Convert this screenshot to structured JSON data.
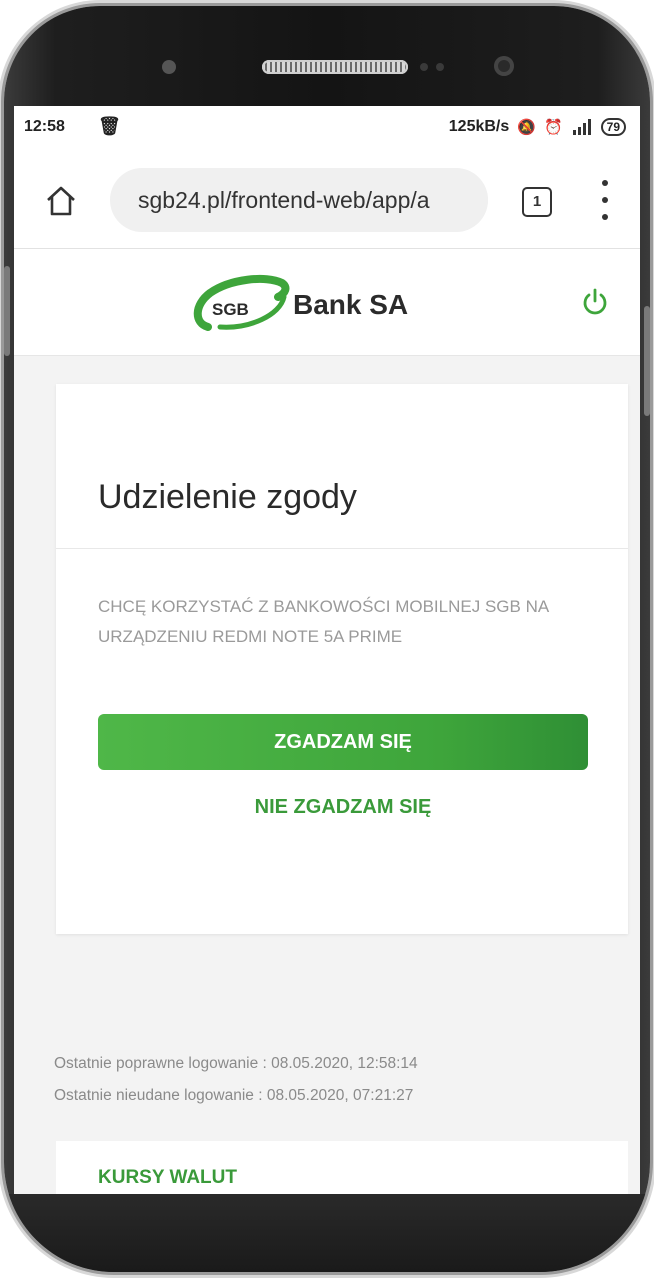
{
  "status_bar": {
    "time": "12:58",
    "trash_icon": "🗑",
    "network_speed": "125kB/s",
    "mute_icon": "🔕",
    "alarm_icon": "⏰",
    "signal_icon": "signal",
    "battery": "79"
  },
  "browser": {
    "url": "sgb24.pl/frontend-web/app/a",
    "tab_count": "1"
  },
  "header": {
    "logo_badge": "SGB",
    "logo_text": "Bank SA",
    "accent_color": "#3a9a3a"
  },
  "consent_card": {
    "title": "Udzielenie zgody",
    "text": "CHCĘ KORZYSTAĆ Z BANKOWOŚCI MOBILNEJ SGB NA URZĄDZENIU REDMI NOTE 5A PRIME",
    "agree_label": "ZGADZAM SIĘ",
    "disagree_label": "NIE ZGADZAM SIĘ"
  },
  "login_info": {
    "last_success": "Ostatnie poprawne logowanie : 08.05.2020, 12:58:14",
    "last_failed": "Ostatnie nieudane logowanie : 08.05.2020, 07:21:27"
  },
  "rates": {
    "title": "KURSY WALUT"
  }
}
